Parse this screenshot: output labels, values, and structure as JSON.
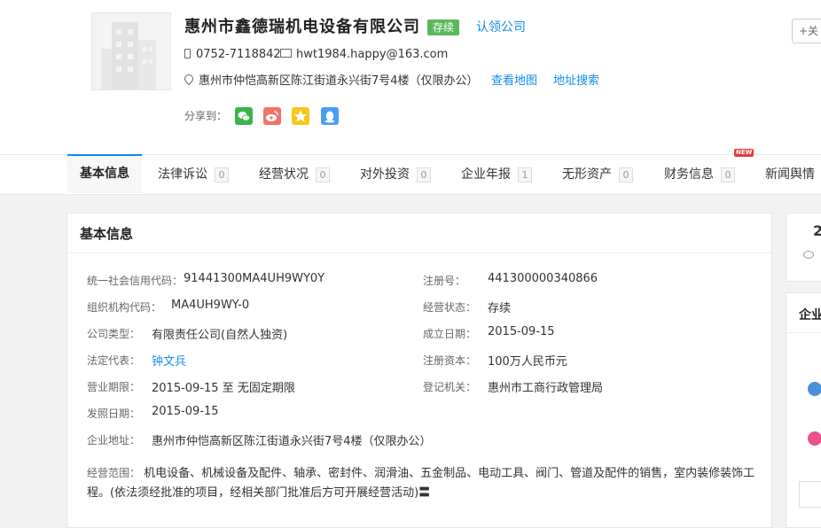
{
  "company": {
    "name": "惠州市鑫德瑞机电设备有限公司",
    "status": "存续",
    "claim_label": "认领公司",
    "follow_label": "+关",
    "phone": "0752-7118842",
    "email": "hwt1984.happy@163.com",
    "address": "惠州市仲恺高新区陈江街道永兴街7号4楼（仅限办公）",
    "view_map": "查看地图",
    "address_search": "地址搜索",
    "share_label": "分享到："
  },
  "share_icons": [
    {
      "name": "wechat-icon",
      "color": "#3bb34a"
    },
    {
      "name": "weibo-icon",
      "color": "#f0736a"
    },
    {
      "name": "qzone-icon",
      "color": "#f7c81c"
    },
    {
      "name": "qq-icon",
      "color": "#4a9ff5"
    }
  ],
  "tabs": [
    {
      "label": "基本信息",
      "count": ""
    },
    {
      "label": "法律诉讼",
      "count": "0"
    },
    {
      "label": "经营状况",
      "count": "0"
    },
    {
      "label": "对外投资",
      "count": "0"
    },
    {
      "label": "企业年报",
      "count": "1"
    },
    {
      "label": "无形资产",
      "count": "0"
    },
    {
      "label": "财务信息",
      "count": "0"
    },
    {
      "label": "新闻舆情",
      "count": ""
    }
  ],
  "new_badge": "NEW",
  "basic_info": {
    "title": "基本信息",
    "fields": [
      {
        "label": "统一社会信用代码：",
        "value": "91441300MA4UH9WY0Y"
      },
      {
        "label": "注册号：",
        "value": "441300000340866"
      },
      {
        "label": "组织机构代码：",
        "value": "MA4UH9WY-0"
      },
      {
        "label": "经营状态：",
        "value": "存续"
      },
      {
        "label": "公司类型：",
        "value": "有限责任公司(自然人独资)"
      },
      {
        "label": "成立日期：",
        "value": "2015-09-15"
      },
      {
        "label": "法定代表：",
        "value": "钟文兵"
      },
      {
        "label": "注册资本：",
        "value": "100万人民币元"
      },
      {
        "label": "营业期限：",
        "value": "2015-09-15 至 无固定期限"
      },
      {
        "label": "登记机关：",
        "value": "惠州市工商行政管理局"
      },
      {
        "label": "发照日期：",
        "value": "2015-09-15"
      },
      {
        "label": "企业地址：",
        "value": "惠州市仲恺高新区陈江街道永兴街7号4楼（仅限办公）"
      }
    ],
    "scope_label": "经营范围：",
    "scope_value": "机电设备、机械设备及配件、轴承、密封件、润滑油、五金制品、电动工具、阀门、管道及配件的销售，室内装修装饰工程。(依法须经批准的项目，经相关部门批准后方可开展经营活动)〓"
  },
  "side": {
    "stat_partial": "2",
    "panel_title_partial": "企业"
  }
}
